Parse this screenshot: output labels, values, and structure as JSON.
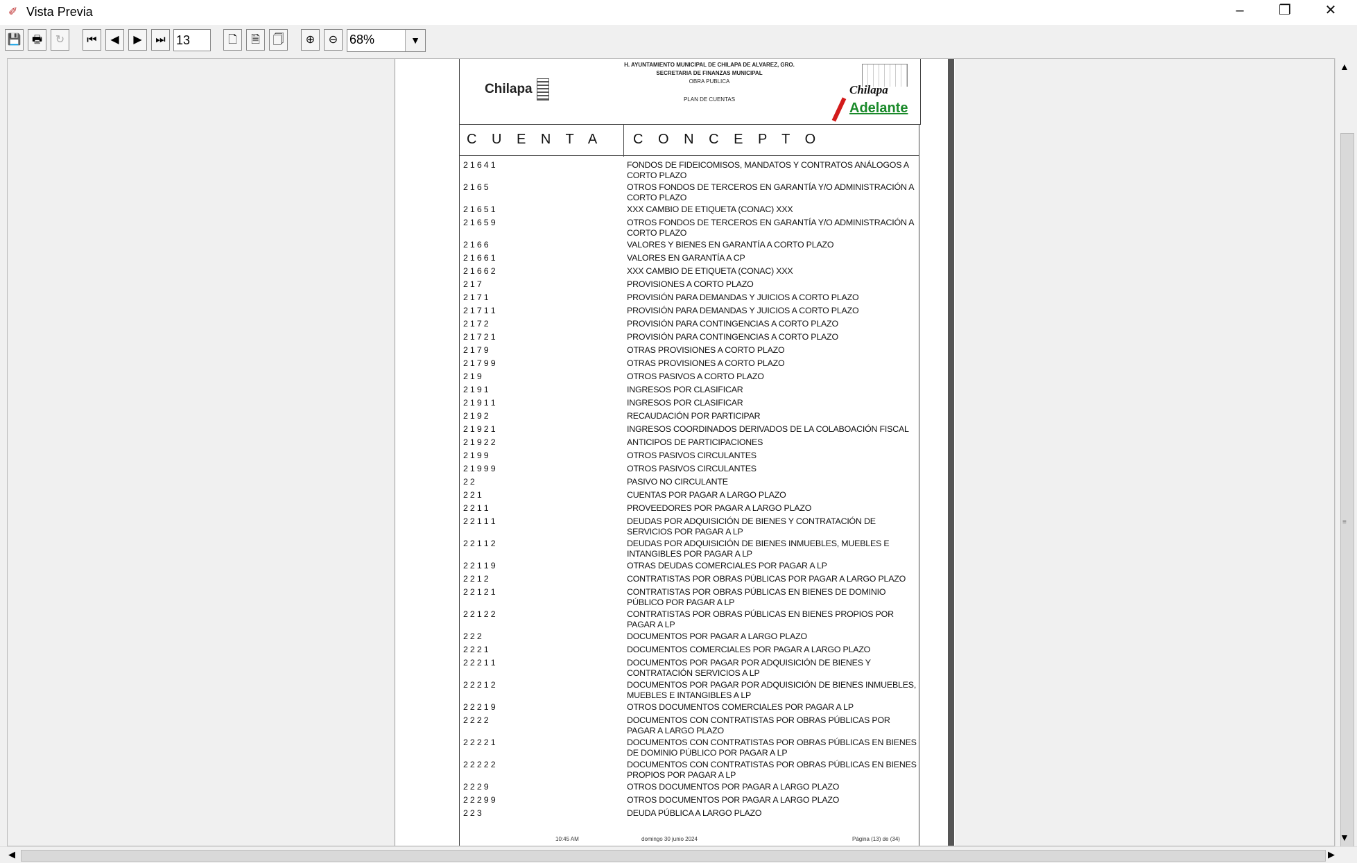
{
  "window": {
    "title": "Vista Previa",
    "app_icon": "preview-icon",
    "controls": {
      "minimize": "–",
      "restore": "❐",
      "close": "✕"
    }
  },
  "toolbar": {
    "save": "💾",
    "print": "🖶",
    "refresh": "↻",
    "first": "⏮",
    "prev": "◀",
    "next": "▶",
    "last": "⏭",
    "page": "13",
    "single_page": "🗋",
    "page_width": "🗎",
    "whole_page": "🗍",
    "zoom_in": "⊕",
    "zoom_out": "⊖",
    "zoom": "68%",
    "zoom_arrow": "▼"
  },
  "document": {
    "header": {
      "logo_left": "Chilapa",
      "line1": "H. AYUNTAMIENTO MUNICIPAL DE CHILAPA DE ALVAREZ, GRO.",
      "line2": "SECRETARIA DE FINANZAS MUNICIPAL",
      "line3": "OBRA PUBLICA",
      "line4": "PLAN DE CUENTAS",
      "logo_right_top": "Chilapa",
      "logo_right_bottom": "Adelante"
    },
    "columns": {
      "account": "C U E N T A",
      "concept": "C O N C E P T O"
    },
    "rows": [
      {
        "account": "2 1 6 4 1",
        "concept": "FONDOS DE FIDEICOMISOS, MANDATOS Y CONTRATOS ANÁLOGOS A CORTO PLAZO",
        "tall": true
      },
      {
        "account": "2 1 6 5",
        "concept": "OTROS FONDOS DE TERCEROS EN GARANTÍA Y/O ADMINISTRACIÓN A CORTO PLAZO",
        "tall": true
      },
      {
        "account": "2 1 6 5 1",
        "concept": "XXX CAMBIO DE ETIQUETA (CONAC) XXX"
      },
      {
        "account": "2 1 6 5 9",
        "concept": "OTROS FONDOS DE TERCEROS EN GARANTÍA Y/O ADMINISTRACIÓN A CORTO PLAZO",
        "tall": true
      },
      {
        "account": "2 1 6 6",
        "concept": "VALORES Y BIENES EN GARANTÍA A CORTO PLAZO"
      },
      {
        "account": "2 1 6 6 1",
        "concept": "VALORES EN GARANTÍA A CP"
      },
      {
        "account": "2 1 6 6 2",
        "concept": "XXX CAMBIO DE ETIQUETA (CONAC) XXX"
      },
      {
        "account": "2 1 7",
        "concept": "PROVISIONES A CORTO PLAZO"
      },
      {
        "account": "2 1 7 1",
        "concept": "PROVISIÓN PARA DEMANDAS Y JUICIOS A CORTO PLAZO"
      },
      {
        "account": "2 1 7 1 1",
        "concept": "PROVISIÓN PARA DEMANDAS Y JUICIOS A CORTO PLAZO"
      },
      {
        "account": "2 1 7 2",
        "concept": "PROVISIÓN PARA CONTINGENCIAS A CORTO PLAZO"
      },
      {
        "account": "2 1 7 2 1",
        "concept": "PROVISIÓN PARA CONTINGENCIAS A CORTO PLAZO"
      },
      {
        "account": "2 1 7 9",
        "concept": "OTRAS PROVISIONES A CORTO PLAZO"
      },
      {
        "account": "2 1 7 9 9",
        "concept": "OTRAS PROVISIONES A CORTO PLAZO"
      },
      {
        "account": "2 1 9",
        "concept": "OTROS PASIVOS A CORTO PLAZO"
      },
      {
        "account": "2 1 9 1",
        "concept": "INGRESOS POR CLASIFICAR"
      },
      {
        "account": "2 1 9 1 1",
        "concept": "INGRESOS POR CLASIFICAR"
      },
      {
        "account": "2 1 9 2",
        "concept": "RECAUDACIÓN POR PARTICIPAR"
      },
      {
        "account": "2 1 9 2 1",
        "concept": "INGRESOS COORDINADOS DERIVADOS DE LA COLABOACIÓN FISCAL"
      },
      {
        "account": "2 1 9 2 2",
        "concept": "ANTICIPOS DE PARTICIPACIONES"
      },
      {
        "account": "2 1 9 9",
        "concept": "OTROS PASIVOS CIRCULANTES"
      },
      {
        "account": "2 1 9 9 9",
        "concept": "OTROS PASIVOS CIRCULANTES"
      },
      {
        "account": "2 2",
        "concept": "PASIVO NO CIRCULANTE"
      },
      {
        "account": "2 2 1",
        "concept": "CUENTAS POR PAGAR A LARGO PLAZO"
      },
      {
        "account": "2 2 1 1",
        "concept": "PROVEEDORES POR PAGAR A LARGO PLAZO"
      },
      {
        "account": "2 2 1 1 1",
        "concept": "DEUDAS POR ADQUISICIÓN DE BIENES Y CONTRATACIÓN DE SERVICIOS POR PAGAR A LP",
        "tall": true
      },
      {
        "account": "2 2 1 1 2",
        "concept": "DEUDAS POR ADQUISICIÓN DE BIENES INMUEBLES, MUEBLES E INTANGIBLES POR PAGAR A LP",
        "tall": true
      },
      {
        "account": "2 2 1 1 9",
        "concept": "OTRAS DEUDAS COMERCIALES POR PAGAR A LP"
      },
      {
        "account": "2 2 1 2",
        "concept": "CONTRATISTAS POR OBRAS PÚBLICAS POR PAGAR A LARGO PLAZO"
      },
      {
        "account": "2 2 1 2 1",
        "concept": "CONTRATISTAS POR OBRAS PÚBLICAS EN BIENES DE DOMINIO PÚBLICO POR PAGAR A LP",
        "tall": true
      },
      {
        "account": "2 2 1 2 2",
        "concept": "CONTRATISTAS POR OBRAS PÚBLICAS EN BIENES PROPIOS POR PAGAR A LP",
        "tall": true
      },
      {
        "account": "2 2 2",
        "concept": "DOCUMENTOS POR PAGAR A LARGO PLAZO"
      },
      {
        "account": "2 2 2 1",
        "concept": "DOCUMENTOS COMERCIALES POR PAGAR A LARGO PLAZO"
      },
      {
        "account": "2 2 2 1 1",
        "concept": "DOCUMENTOS POR PAGAR POR ADQUISICIÓN DE BIENES Y CONTRATACIÓN SERVICIOS A LP",
        "tall": true
      },
      {
        "account": "2 2 2 1 2",
        "concept": "DOCUMENTOS POR PAGAR POR ADQUISICIÓN DE BIENES INMUEBLES, MUEBLES E INTANGIBLES A LP",
        "tall": true
      },
      {
        "account": "2 2 2 1 9",
        "concept": "OTROS DOCUMENTOS COMERCIALES POR PAGAR A LP"
      },
      {
        "account": "2 2 2 2",
        "concept": "DOCUMENTOS CON CONTRATISTAS POR OBRAS PÚBLICAS POR PAGAR A LARGO PLAZO",
        "tall": true
      },
      {
        "account": "2 2 2 2 1",
        "concept": "DOCUMENTOS CON CONTRATISTAS POR OBRAS PÚBLICAS EN BIENES DE DOMINIO PÚBLICO POR PAGAR A LP",
        "tall": true
      },
      {
        "account": "2 2 2 2 2",
        "concept": "DOCUMENTOS CON CONTRATISTAS POR OBRAS PÚBLICAS EN BIENES PROPIOS POR PAGAR A LP",
        "tall": true
      },
      {
        "account": "2 2 2 9",
        "concept": "OTROS DOCUMENTOS POR PAGAR A LARGO PLAZO"
      },
      {
        "account": "2 2 2 9 9",
        "concept": "OTROS DOCUMENTOS POR PAGAR A LARGO PLAZO"
      },
      {
        "account": "2 2 3",
        "concept": "DEUDA PÚBLICA A LARGO PLAZO"
      }
    ],
    "footer": {
      "time": "10:45 AM",
      "date": "domingo 30 junio 2024",
      "page": "Página (13) de (34)"
    }
  },
  "scrollbars": {
    "up": "▲",
    "down": "▼",
    "left": "◀",
    "right": "▶",
    "grip": "≡"
  }
}
